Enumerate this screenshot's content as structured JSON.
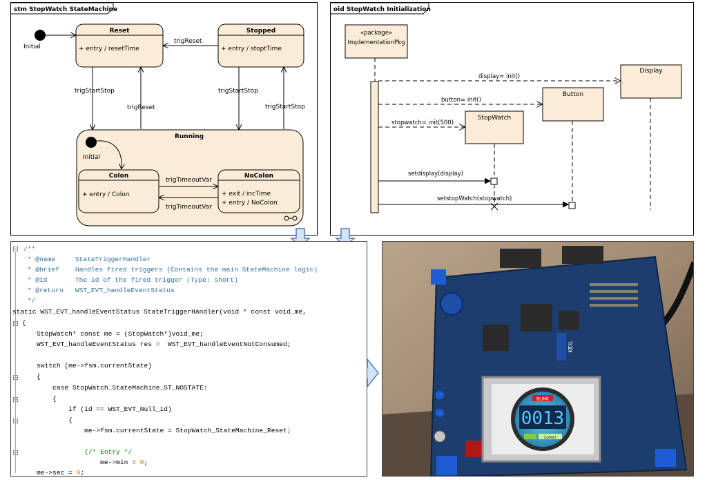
{
  "stm": {
    "title": "stm StopWatch StateMachine",
    "initial": "Initial",
    "states": {
      "reset": {
        "name": "Reset",
        "action": "+ entry / resetTime"
      },
      "stopped": {
        "name": "Stopped",
        "action": "+ entry / stoptTime"
      },
      "running": {
        "name": "Running",
        "initial": "Initial"
      },
      "colon": {
        "name": "Colon",
        "action": "+ entry / Colon"
      },
      "nocolon": {
        "name": "NoColon",
        "action1": "+ exit / incTime",
        "action2": "+ entry / NoColon"
      }
    },
    "transitions": {
      "trigReset_top": "trigReset",
      "trigStartStop_left": "trigStartStop",
      "trigReset_mid": "trigReset",
      "trigStartStop_mid": "trigStartStop",
      "trigStartStop_right": "trigStartStop",
      "trigTimeoutVar_top": "trigTimeoutVar",
      "trigTimeoutVar_bottom": "trigTimeoutVar"
    }
  },
  "oid": {
    "title": "oid StopWatch Initialization",
    "package_stereotype": "«package»",
    "package_name": "ImplementationPkg",
    "lifelines": {
      "display": "Display",
      "button": "Button",
      "stopwatch": "StopWatch"
    },
    "messages": {
      "m1": "display= init()",
      "m2": "button= init()",
      "m3": "stopwatch= init(500)",
      "m4": "setdisplay(display)",
      "m5": "setstopWatch(stopwatch)"
    }
  },
  "code": {
    "lines": [
      {
        "text": "/**",
        "kind": "cm"
      },
      {
        "text": " * @name     StateTriggerHandler",
        "kind": "cm"
      },
      {
        "text": " * @brief    Handles fired triggers (Contains the main StateMachine logic)",
        "kind": "cm"
      },
      {
        "text": " * @id       The id of the fired trigger (Type: short)",
        "kind": "cm"
      },
      {
        "text": " * @return   WST_EVT_handleEventStatus",
        "kind": "cm"
      },
      {
        "text": " */",
        "kind": "cm"
      },
      {
        "text": "static WST_EVT_handleEventStatus StateTriggerHandler(void * const void_me,",
        "kind": "code"
      },
      {
        "text": "{",
        "kind": "code"
      },
      {
        "text": "    StopWatch* const me = (StopWatch*)void_me;",
        "kind": "code"
      },
      {
        "text": "    WST_EVT_handleEventStatus res =  WST_EVT_handleEventNotConsumed;",
        "kind": "code"
      },
      {
        "text": "",
        "kind": "code"
      },
      {
        "text": "    switch (me->fsm.currentState)",
        "kind": "code"
      },
      {
        "text": "    {",
        "kind": "code"
      },
      {
        "text": "        case StopWatch_StateMachine_ST_NOSTATE:",
        "kind": "code"
      },
      {
        "text": "        {",
        "kind": "code"
      },
      {
        "text": "            if (id == WST_EVT_Null_id)",
        "kind": "code"
      },
      {
        "text": "            {",
        "kind": "code"
      },
      {
        "text": "                me->fsm.currentState = StopWatch_StateMachine_Reset;",
        "kind": "code"
      },
      {
        "text": "",
        "kind": "code"
      },
      {
        "text": "                {/* Entry */",
        "kind": "entry"
      },
      {
        "text": "                    me->min = 0;",
        "kind": "zero"
      },
      {
        "text": "    me->sec = 0;",
        "kind": "zero"
      }
    ]
  },
  "photo": {
    "display_digits": "0013",
    "display_tag": "BLINK",
    "lower_label": "Lower",
    "board_logo": "KEIL"
  },
  "colors": {
    "state_fill": "#fbecd8",
    "note_fill": "#fbecd8",
    "arrow_fill": "#d4e4f4",
    "arrow_stroke": "#4f7fb5",
    "comment": "#2e6e9e"
  }
}
